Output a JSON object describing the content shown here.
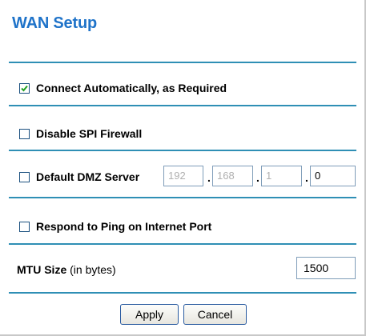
{
  "page": {
    "title": "WAN Setup"
  },
  "options": {
    "connect_auto": {
      "label": "Connect Automatically, as Required",
      "checked": true
    },
    "disable_spi": {
      "label": "Disable SPI Firewall",
      "checked": false
    },
    "dmz": {
      "label": "Default DMZ Server",
      "checked": false,
      "octets": [
        "192",
        "168",
        "1",
        "0"
      ]
    },
    "respond_ping": {
      "label": "Respond to Ping on Internet Port",
      "checked": false
    }
  },
  "mtu": {
    "label": "MTU Size",
    "unit": "(in bytes)",
    "value": "1500"
  },
  "buttons": {
    "apply": "Apply",
    "cancel": "Cancel"
  },
  "colors": {
    "title": "#1f73c9",
    "rule": "#2f8fb5",
    "checkbox_border": "#1c5180"
  }
}
